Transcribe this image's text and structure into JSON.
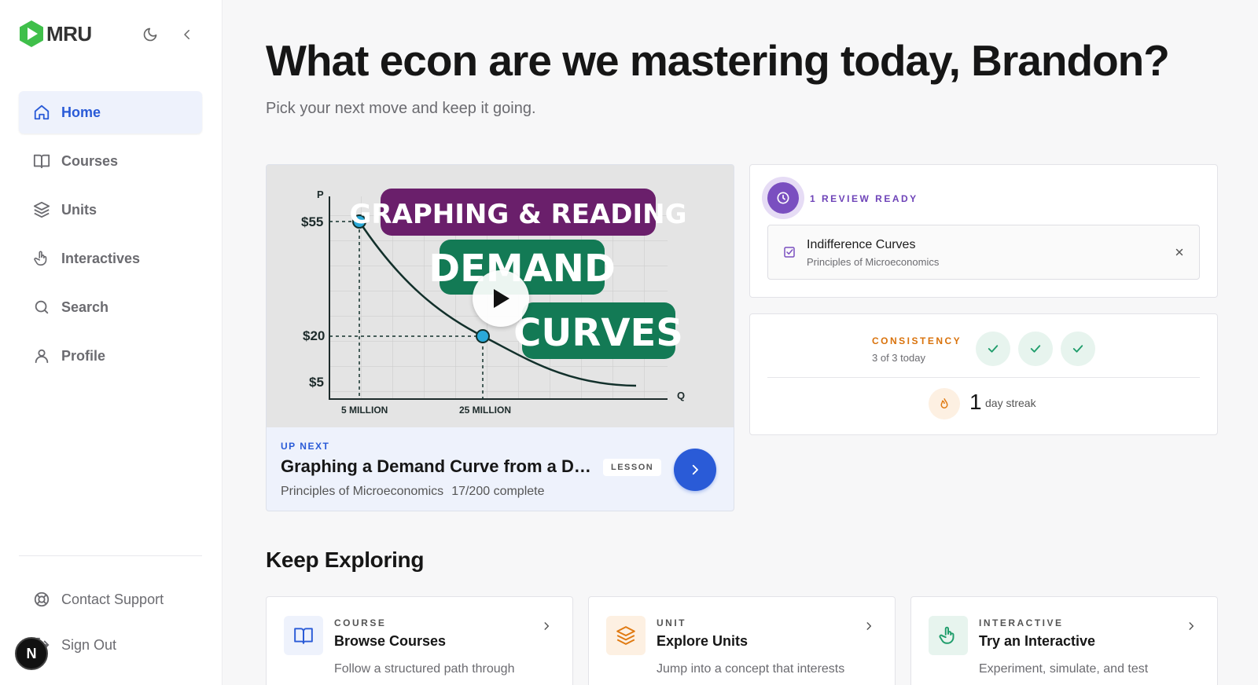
{
  "app": {
    "logo_text": "MRU"
  },
  "sidebar": {
    "items": [
      {
        "label": "Home",
        "icon": "home-icon",
        "active": true
      },
      {
        "label": "Courses",
        "icon": "book-icon",
        "active": false
      },
      {
        "label": "Units",
        "icon": "layers-icon",
        "active": false
      },
      {
        "label": "Interactives",
        "icon": "pointer-hand-icon",
        "active": false
      },
      {
        "label": "Search",
        "icon": "search-icon",
        "active": false
      },
      {
        "label": "Profile",
        "icon": "user-icon",
        "active": false
      }
    ],
    "contact_support": "Contact Support",
    "sign_out": "Sign Out",
    "avatar_letter": "N"
  },
  "main": {
    "headline": "What econ are we mastering today, Brandon?",
    "subline": "Pick your next move and keep it going."
  },
  "video": {
    "thumb_title_line1": "GRAPHING & READING",
    "thumb_title_line2": "DEMAND",
    "thumb_title_line3": "CURVES",
    "axis_p": "P",
    "axis_q": "Q",
    "tick_55": "$55",
    "tick_20": "$20",
    "tick_5": "$5",
    "tick_5m": "5 MILLION",
    "tick_25m": "25 MILLION",
    "up_next": "UP NEXT",
    "lesson_title": "Graphing a Demand Curve from a Demand Schedule",
    "badge": "LESSON",
    "course": "Principles of Microeconomics",
    "progress": "17/200 complete"
  },
  "review": {
    "label": "1 REVIEW READY",
    "item_title": "Indifference Curves",
    "item_course": "Principles of Microeconomics"
  },
  "consistency": {
    "label": "CONSISTENCY",
    "sub": "3 of 3 today",
    "streak_number": "1",
    "streak_label": "day streak"
  },
  "explore": {
    "title": "Keep Exploring",
    "cards": [
      {
        "kind": "COURSE",
        "title": "Browse Courses",
        "desc": "Follow a structured path through",
        "icon": "book-icon"
      },
      {
        "kind": "UNIT",
        "title": "Explore Units",
        "desc": "Jump into a concept that interests",
        "icon": "layers-icon"
      },
      {
        "kind": "INTERACTIVE",
        "title": "Try an Interactive",
        "desc": "Experiment, simulate, and test",
        "icon": "pointer-hand-icon"
      }
    ]
  },
  "colors": {
    "accent_blue": "#2a5bd7",
    "review_purple": "#7a4fc0",
    "consistency_orange": "#d9720b",
    "check_green": "#1f9d6b",
    "logo_green": "#3fbf4a"
  }
}
